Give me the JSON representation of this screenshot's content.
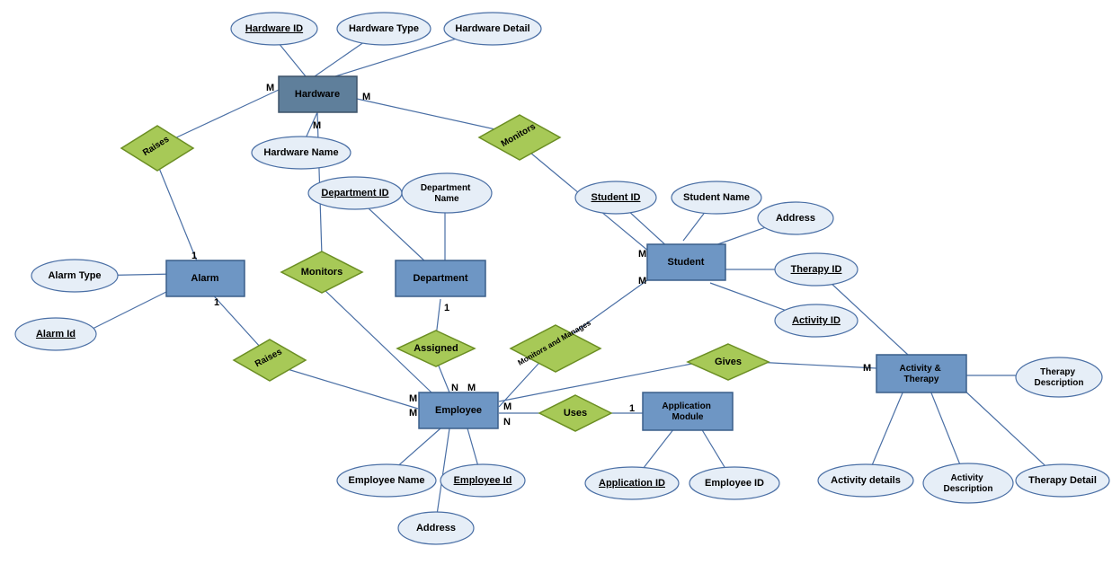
{
  "entities": {
    "hardware": {
      "label": "Hardware"
    },
    "alarm": {
      "label": "Alarm"
    },
    "department": {
      "label": "Department"
    },
    "student": {
      "label": "Student"
    },
    "employee": {
      "label": "Employee"
    },
    "appmodule": {
      "label": "Application Module"
    },
    "activity": {
      "label": "Activity & Therapy"
    }
  },
  "relations": {
    "raises_hw": {
      "label": "Raises"
    },
    "raises_emp": {
      "label": "Raises"
    },
    "monitors_hw_emp": {
      "label": "Monitors"
    },
    "monitors_hw_stu": {
      "label": "Monitors"
    },
    "assigned": {
      "label": "Assigned"
    },
    "uses": {
      "label": "Uses"
    },
    "monman": {
      "label": "Monitors and Manages"
    },
    "gives": {
      "label": "Gives"
    }
  },
  "attributes": {
    "hw_id": {
      "label": "Hardware ID",
      "key": true
    },
    "hw_type": {
      "label": "Hardware Type",
      "key": false
    },
    "hw_detail": {
      "label": "Hardware Detail",
      "key": false
    },
    "hw_name": {
      "label": "Hardware Name",
      "key": false
    },
    "alarm_type": {
      "label": "Alarm Type",
      "key": false
    },
    "alarm_id": {
      "label": "Alarm Id",
      "key": true
    },
    "dept_id": {
      "label": "Department ID",
      "key": true
    },
    "dept_name": {
      "label": "Department Name",
      "key": false
    },
    "stu_id": {
      "label": "Student ID",
      "key": true
    },
    "stu_name": {
      "label": "Student Name",
      "key": false
    },
    "stu_addr": {
      "label": "Address",
      "key": false
    },
    "therapy_id": {
      "label": "Therapy ID",
      "key": true
    },
    "activity_id": {
      "label": "Activity ID",
      "key": true
    },
    "emp_name": {
      "label": "Employee Name",
      "key": false
    },
    "emp_id": {
      "label": "Employee Id",
      "key": true
    },
    "emp_addr": {
      "label": "Address",
      "key": false
    },
    "app_id": {
      "label": "Application ID",
      "key": true
    },
    "app_emp": {
      "label": "Employee ID",
      "key": false
    },
    "act_details": {
      "label": "Activity details",
      "key": false
    },
    "act_desc": {
      "label": "Activity Description",
      "key": false
    },
    "th_desc": {
      "label": "Therapy Description",
      "key": false
    },
    "th_detail": {
      "label": "Therapy Detail",
      "key": false
    }
  },
  "cardinalities": {
    "c_hw_raises": "M",
    "c_hw_mon_stu": "M",
    "c_hw_mon_emp": "M",
    "c_alarm_raises_hw": "1",
    "c_alarm_raises_emp": "1",
    "c_dept_assigned": "1",
    "c_stu_mon_hw": "M",
    "c_stu_monman": "M",
    "c_emp_mon_hw": "M",
    "c_emp_raises": "M",
    "c_emp_assigned": "N",
    "c_emp_monman": "M",
    "c_emp_uses": "N",
    "c_emp_gives": "M",
    "c_app_uses": "1",
    "c_act_gives": "M"
  }
}
